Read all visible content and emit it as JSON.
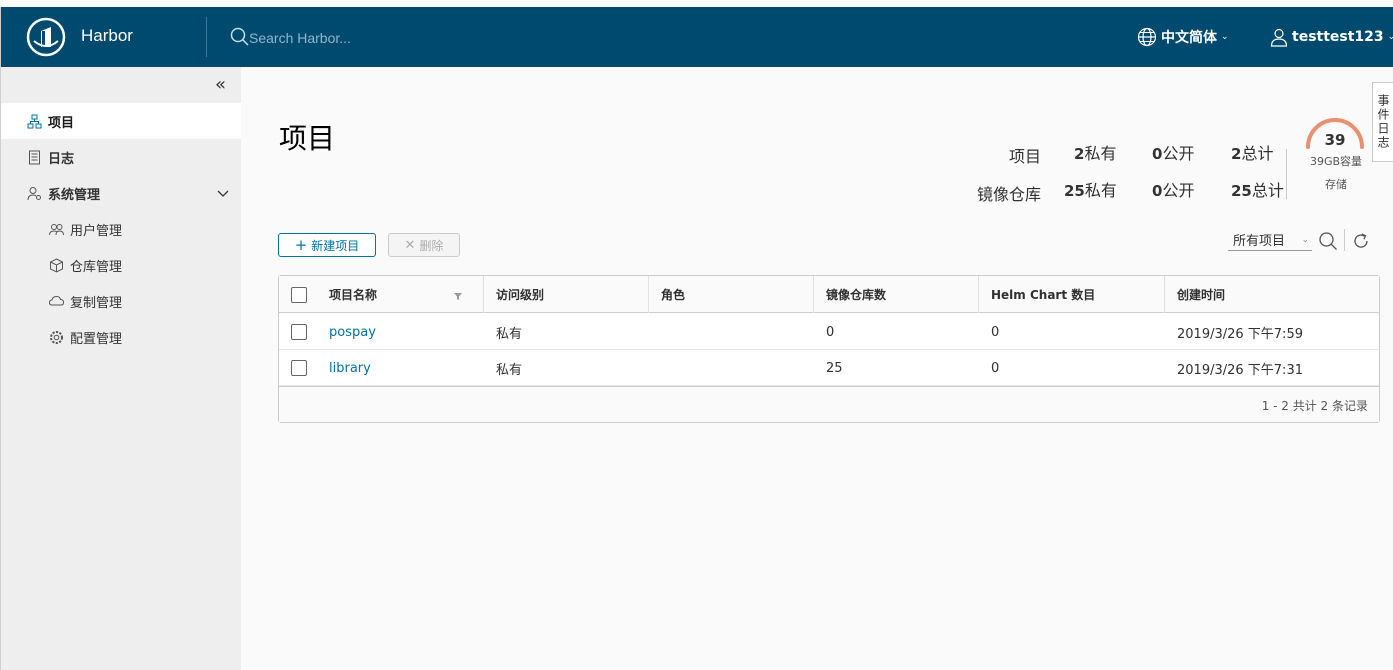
{
  "header": {
    "brand": "Harbor",
    "search_placeholder": "Search Harbor...",
    "language": "中文简体",
    "username": "testtest123"
  },
  "sidebar": {
    "items": [
      {
        "label": "项目",
        "icon": "projects-icon",
        "active": true
      },
      {
        "label": "日志",
        "icon": "log-icon"
      },
      {
        "label": "系统管理",
        "icon": "admin-icon",
        "expanded": true
      }
    ],
    "sub_items": [
      {
        "label": "用户管理",
        "icon": "users-icon"
      },
      {
        "label": "仓库管理",
        "icon": "registry-icon"
      },
      {
        "label": "复制管理",
        "icon": "replication-icon"
      },
      {
        "label": "配置管理",
        "icon": "config-icon"
      }
    ]
  },
  "main": {
    "title": "项目",
    "stats": {
      "projects_label": "项目",
      "repos_label": "镜像仓库",
      "projects_private": "2",
      "projects_public": "0",
      "projects_total": "2",
      "repos_private": "25",
      "repos_public": "0",
      "repos_total": "25",
      "private_suffix": "私有",
      "public_suffix": "公开",
      "total_suffix": "总计"
    },
    "storage": {
      "value": "39",
      "capacity": "39GB容量",
      "label": "存储",
      "gauge_color": "#e8906f"
    },
    "side_tab": "事件日志",
    "toolbar": {
      "new_label": "新建项目",
      "delete_label": "删除",
      "filter_value": "所有项目"
    },
    "table": {
      "columns": [
        "项目名称",
        "访问级别",
        "角色",
        "镜像仓库数",
        "Helm Chart 数目",
        "创建时间"
      ],
      "rows": [
        {
          "name": "pospay",
          "access": "私有",
          "role": "",
          "repos": "0",
          "charts": "0",
          "created": "2019/3/26 下午7:59"
        },
        {
          "name": "library",
          "access": "私有",
          "role": "",
          "repos": "25",
          "charts": "0",
          "created": "2019/3/26 下午7:31"
        }
      ],
      "footer": "1 - 2 共计 2 条记录"
    }
  },
  "colors": {
    "header_bg": "#004a70",
    "link": "#0072a3"
  }
}
